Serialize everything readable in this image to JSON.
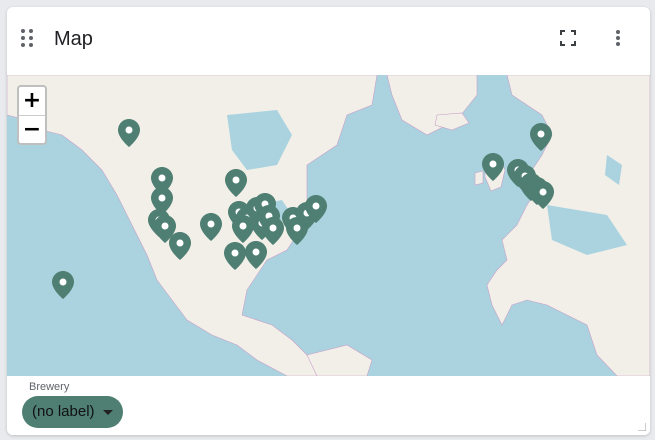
{
  "header": {
    "title": "Map"
  },
  "icons": {
    "drag": "drag-handle-icon",
    "fullscreen": "fullscreen-icon",
    "more": "more-vert-icon",
    "marker": "map-pin-icon"
  },
  "map": {
    "zoom_in_label": "+",
    "zoom_out_label": "−",
    "marker_color": "#4e7f72",
    "land_color": "#f2efe9",
    "water_color": "#aad3df"
  },
  "legend": {
    "title": "Brewery",
    "value": "(no label)"
  }
}
